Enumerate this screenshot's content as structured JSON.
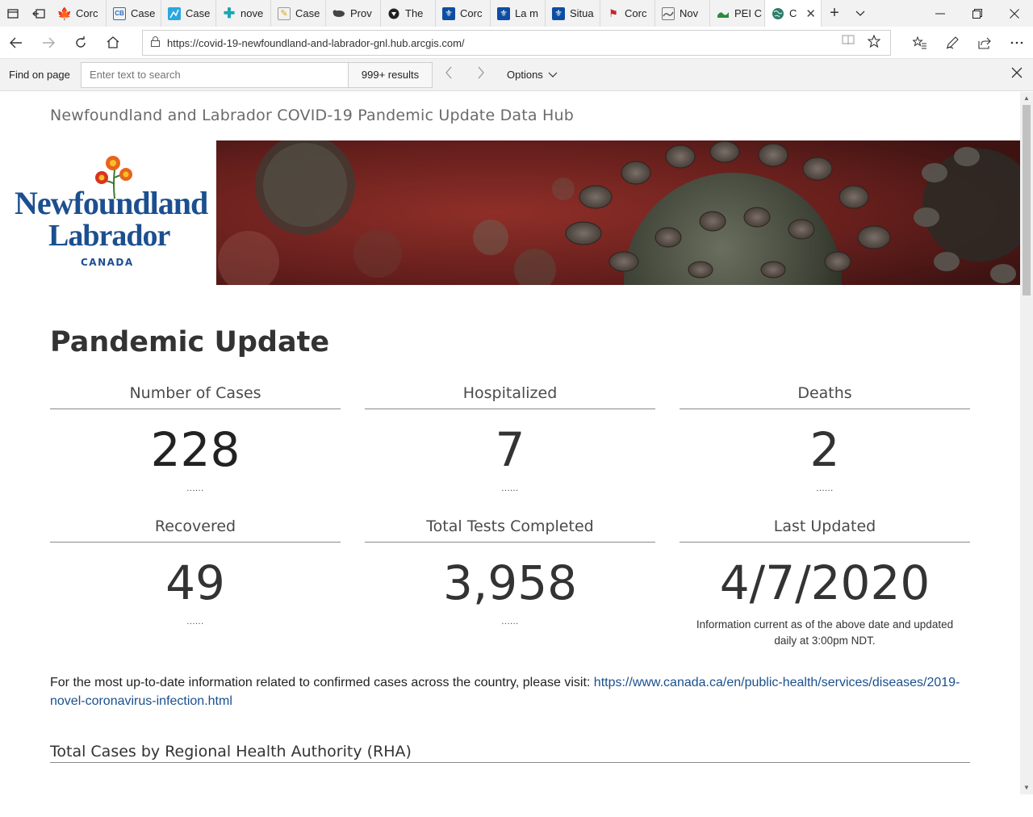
{
  "browser": {
    "tabs": [
      {
        "label": "Corc",
        "icon": "canada-flag-icon",
        "color": "#d52b1e"
      },
      {
        "label": "Case",
        "icon": "cbc-icon",
        "color": "#2a6ebb"
      },
      {
        "label": "Case",
        "icon": "chart-icon",
        "color": "#2aa6e0"
      },
      {
        "label": "nove",
        "icon": "plus-cross-icon",
        "color": "#1ba6b2"
      },
      {
        "label": "Case",
        "icon": "bc-icon",
        "color": "#d8a81c"
      },
      {
        "label": "Prov",
        "icon": "bison-icon",
        "color": "#444444"
      },
      {
        "label": "The",
        "icon": "shield-icon",
        "color": "#333333"
      },
      {
        "label": "Corc",
        "icon": "quebec-icon",
        "color": "#0d4ea3"
      },
      {
        "label": "La m",
        "icon": "quebec-icon",
        "color": "#0d4ea3"
      },
      {
        "label": "Situa",
        "icon": "quebec-icon",
        "color": "#0d4ea3"
      },
      {
        "label": "Corc",
        "icon": "ns-icon",
        "color": "#c2272d"
      },
      {
        "label": "Nov",
        "icon": "nb-icon",
        "color": "#555555"
      },
      {
        "label": "PEI C",
        "icon": "pei-icon",
        "color": "#2b8a3e"
      },
      {
        "label": "C",
        "icon": "globe-icon",
        "color": "#2e7d6b"
      }
    ],
    "url": "https://covid-19-newfoundland-and-labrador-gnl.hub.arcgis.com/",
    "find": {
      "label": "Find on page",
      "placeholder": "Enter text to search",
      "results": "999+ results",
      "options": "Options"
    }
  },
  "page": {
    "site_title": "Newfoundland and Labrador COVID-19 Pandemic Update Data Hub",
    "logo": {
      "line1": "Newfoundland",
      "line2": "Labrador",
      "country": "CANADA"
    },
    "heading": "Pandemic Update",
    "stats": [
      {
        "title": "Number of Cases",
        "value": "228",
        "dots": "......"
      },
      {
        "title": "Hospitalized",
        "value": "7",
        "dots": "......"
      },
      {
        "title": "Deaths",
        "value": "2",
        "dots": "......"
      },
      {
        "title": "Recovered",
        "value": "49",
        "dots": "......"
      },
      {
        "title": "Total Tests Completed",
        "value": "3,958",
        "dots": "......"
      },
      {
        "title": "Last Updated",
        "value": "4/7/2020",
        "note": "Information current as of the above date and updated daily at 3:00pm NDT."
      }
    ],
    "info_text": "For the most up-to-date information related to confirmed cases across the country, please visit:",
    "info_link": "https://www.canada.ca/en/public-health/services/diseases/2019-novel-coronavirus-infection.html",
    "rha_heading": "Total Cases by Regional Health Authority (RHA)"
  }
}
